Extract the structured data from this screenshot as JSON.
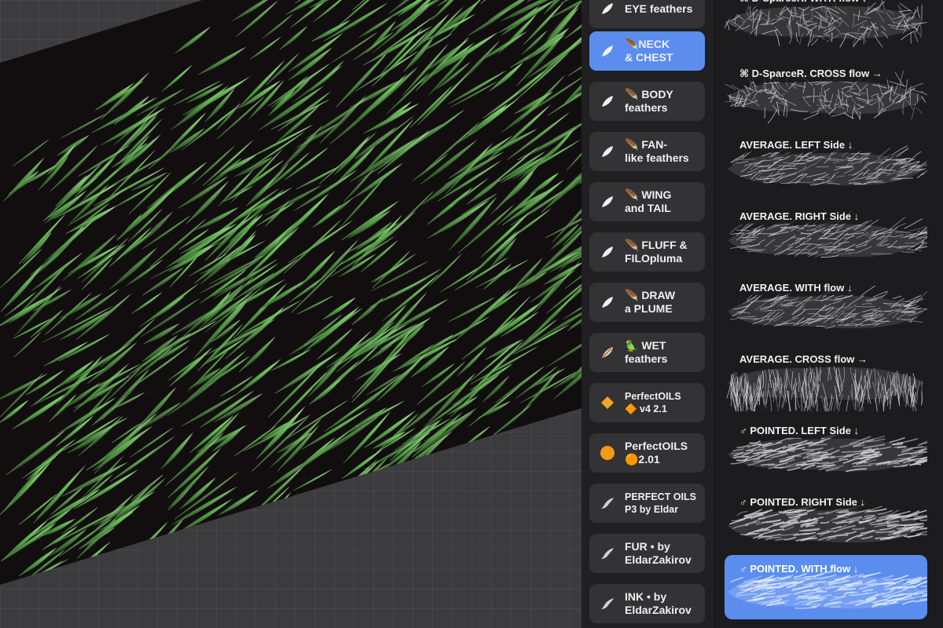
{
  "library": {
    "items": [
      {
        "label": "EYE feathers",
        "icon": "feather-icon",
        "selected": false
      },
      {
        "label": "🪶NECK\n& CHEST",
        "icon": "feather-icon",
        "selected": true
      },
      {
        "label": "🪶 BODY\nfeathers",
        "icon": "feather-icon",
        "selected": false
      },
      {
        "label": "🪶 FAN-\nlike feathers",
        "icon": "feather-icon",
        "selected": false
      },
      {
        "label": "🪶 WING\nand TAIL",
        "icon": "feather-icon",
        "selected": false
      },
      {
        "label": "🪶 FLUFF &\nFILOpluma",
        "icon": "feather-icon",
        "selected": false
      },
      {
        "label": "🪶 DRAW\na PLUME",
        "icon": "feather-icon",
        "selected": false
      },
      {
        "label": "🦜 WET\nfeathers",
        "icon": "feather-emoji-icon",
        "selected": false
      },
      {
        "label": "PerfectOILS\n🔶 v4 2.1",
        "icon": "orange-diamond-icon",
        "selected": false
      },
      {
        "label": "PerfectOILS\n🟠2.01",
        "icon": "orange-circle-icon",
        "selected": false
      },
      {
        "label": "PERFECT OILS\nP3 by Eldar",
        "icon": "brush-stroke-icon",
        "selected": false
      },
      {
        "label": "FUR • by\nEldarZakirov",
        "icon": "brush-stroke-icon",
        "selected": false
      },
      {
        "label": "INK • by\nEldarZakirov",
        "icon": "brush-stroke-icon",
        "selected": false
      }
    ]
  },
  "brushes": {
    "items": [
      {
        "name": "⌘ D-SparceR. WITH flow ↓",
        "selected": false
      },
      {
        "name": "⌘ D-SparceR. CROSS flow →",
        "selected": false
      },
      {
        "name": "AVERAGE. LEFT Side ↓",
        "selected": false
      },
      {
        "name": "AVERAGE. RIGHT Side ↓",
        "selected": false
      },
      {
        "name": "AVERAGE. WITH flow ↓",
        "selected": false
      },
      {
        "name": "AVERAGE. CROSS flow →",
        "selected": false
      },
      {
        "name": "♂ POINTED. LEFT Side ↓",
        "selected": false
      },
      {
        "name": "♂ POINTED. RIGHT Side ↓",
        "selected": false
      },
      {
        "name": "♂ POINTED. WITH flow ↓",
        "selected": true
      }
    ]
  },
  "colors": {
    "feather_green": "#5fb04f",
    "selected_blue": "#5b8def",
    "canvas_black": "#120e0f"
  }
}
